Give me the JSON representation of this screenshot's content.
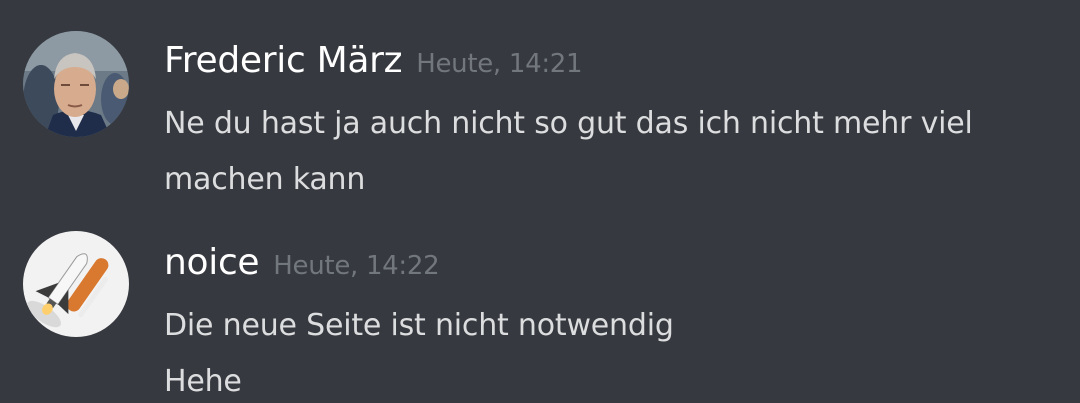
{
  "messages": [
    {
      "author": "Frederic März",
      "timestamp": "Heute, 14:21",
      "avatar_icon": "man-portrait-avatar",
      "lines": [
        "Ne du hast ja auch nicht so gut das ich nicht mehr viel",
        "machen kann"
      ]
    },
    {
      "author": "noice",
      "timestamp": "Heute, 14:22",
      "avatar_icon": "space-shuttle-avatar",
      "lines": [
        "Die neue Seite ist nicht notwendig",
        "Hehe"
      ]
    }
  ],
  "colors": {
    "background": "#36393f",
    "author": "#ffffff",
    "timestamp": "#72767d",
    "text": "#dcddde"
  }
}
